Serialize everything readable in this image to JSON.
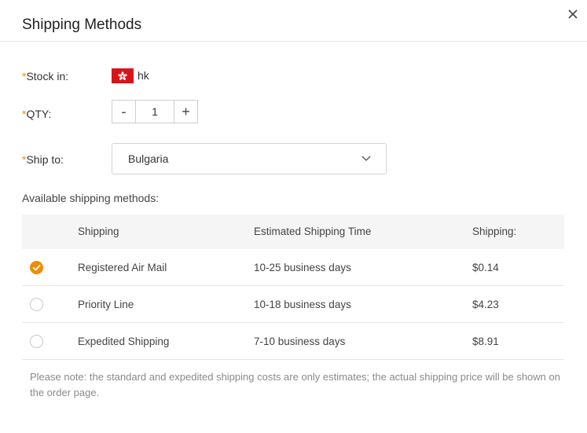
{
  "dialog": {
    "title": "Shipping Methods"
  },
  "form": {
    "required_mark": "*",
    "stock_label": "Stock in:",
    "stock_value": "hk",
    "qty_label": "QTY:",
    "qty_value": "1",
    "qty_minus": "-",
    "qty_plus": "+",
    "ship_to_label": "Ship to:",
    "ship_to_value": "Bulgaria"
  },
  "available_label": "Available shipping methods:",
  "table": {
    "headers": {
      "shipping": "Shipping",
      "time": "Estimated Shipping Time",
      "price": "Shipping:"
    },
    "rows": [
      {
        "method": "Registered Air Mail",
        "time": "10-25 business days",
        "price": "$0.14",
        "selected": true
      },
      {
        "method": "Priority Line",
        "time": "10-18 business days",
        "price": "$4.23",
        "selected": false
      },
      {
        "method": "Expedited Shipping",
        "time": "7-10 business days",
        "price": "$8.91",
        "selected": false
      }
    ]
  },
  "note": "Please note: the standard and expedited shipping costs are only estimates; the actual shipping price will be shown on the order page.",
  "colors": {
    "accent": "#f08c00",
    "flag": "#d7141a",
    "header_bg": "#f5f5f5"
  },
  "icons": {
    "close": "close-icon",
    "flag": "hong-kong-flag-icon",
    "dropdown": "chevron-down-icon",
    "radio_checked": "check-icon"
  }
}
